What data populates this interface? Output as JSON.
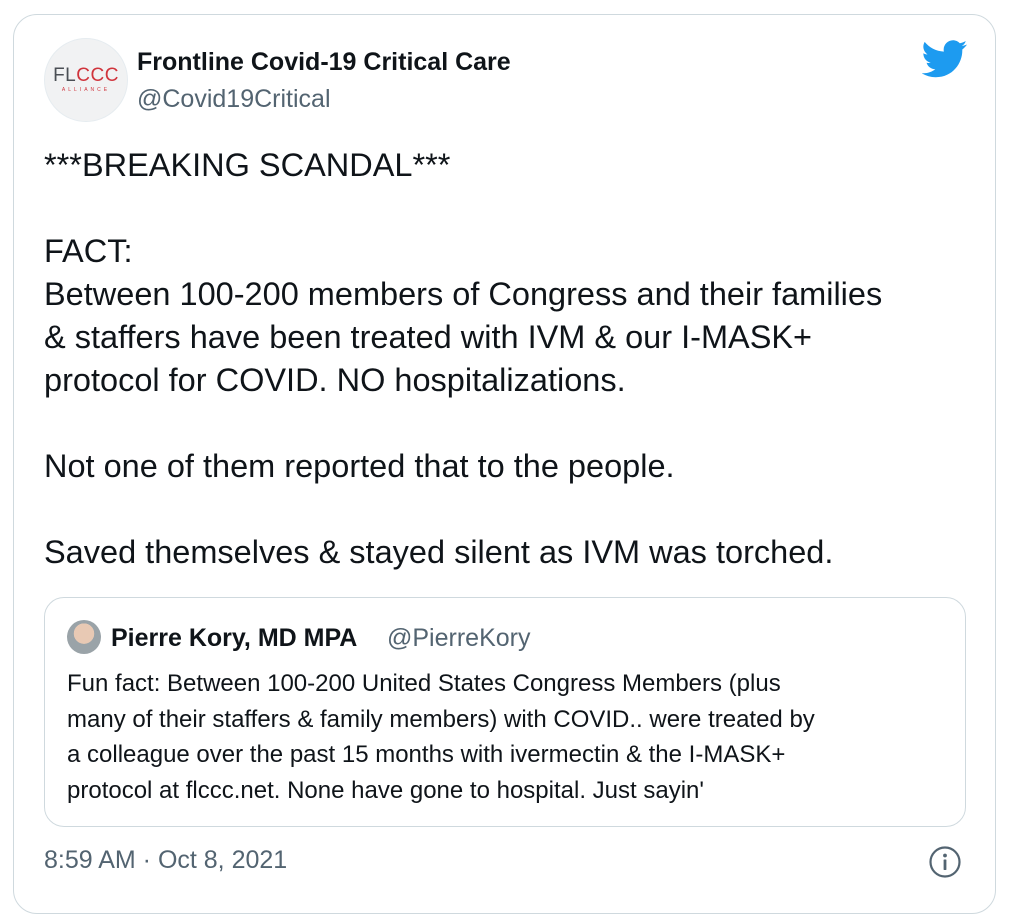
{
  "tweet": {
    "author_name": "Frontline Covid-19 Critical Care",
    "author_handle": "@Covid19Critical",
    "avatar_logo_a": "FL",
    "avatar_logo_b": "CCC",
    "avatar_logo_sub": "ALLIANCE",
    "platform_icon": "twitter-bird-icon",
    "lines": [
      "***BREAKING SCANDAL***",
      "FACT:",
      "Between 100-200 members of Congress and their families",
      "& staffers have been treated with IVM & our I-MASK+",
      "protocol for COVID. NO hospitalizations.",
      "Not one of them reported that to the people.",
      "Saved themselves & stayed silent as IVM was torched."
    ],
    "timestamp": "8:59 AM · Oct 8, 2021",
    "info_icon": "info-icon"
  },
  "quoted_tweet": {
    "author_name": "Pierre Kory, MD MPA",
    "author_handle": "@PierreKory",
    "lines": [
      "Fun fact: Between 100-200 United States Congress Members (plus",
      "many of their staffers & family members) with COVID.. were treated by",
      "a colleague over the past 15 months with ivermectin & the I-MASK+",
      "protocol at flccc.net. None have gone to hospital. Just sayin'"
    ]
  },
  "colors": {
    "text": "#0f1419",
    "secondary": "#536471",
    "border": "#cfd9de",
    "twitter_blue": "#1d9bf0",
    "logo_red": "#d0343c"
  }
}
